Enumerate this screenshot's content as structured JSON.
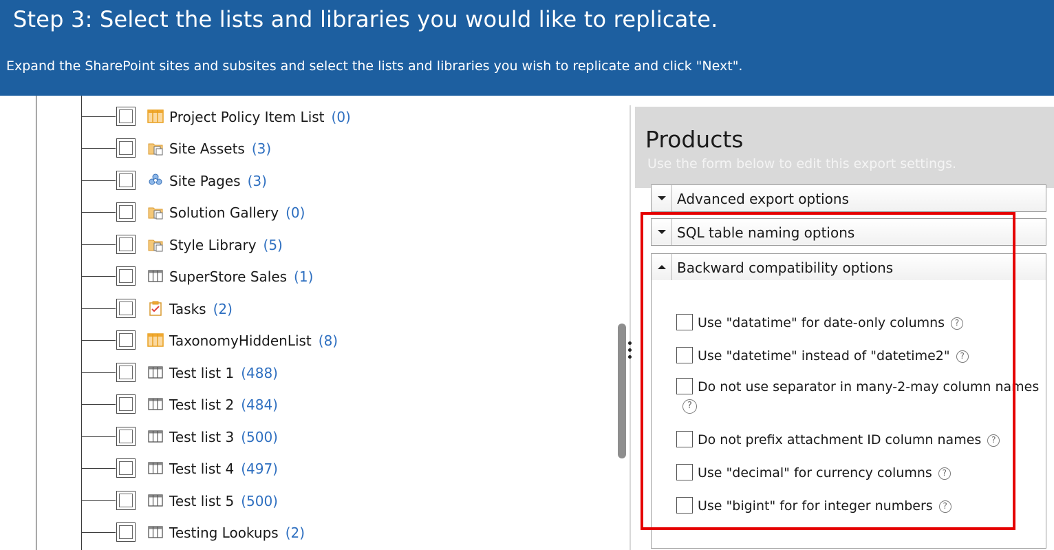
{
  "header": {
    "title": "Step 3: Select the lists and libraries you would like to replicate.",
    "subtitle": "Expand the SharePoint sites and subsites and select the lists and libraries you wish to replicate and click \"Next\"."
  },
  "tree": {
    "items": [
      {
        "label": "Project Policy Item List",
        "count": "(0)",
        "icon": "table-orange-icon"
      },
      {
        "label": "Site Assets",
        "count": "(3)",
        "icon": "library-icon"
      },
      {
        "label": "Site Pages",
        "count": "(3)",
        "icon": "site-pages-icon"
      },
      {
        "label": "Solution Gallery",
        "count": "(0)",
        "icon": "library-icon"
      },
      {
        "label": "Style Library",
        "count": "(5)",
        "icon": "library-icon"
      },
      {
        "label": "SuperStore Sales",
        "count": "(1)",
        "icon": "list-icon"
      },
      {
        "label": "Tasks",
        "count": "(2)",
        "icon": "tasks-icon"
      },
      {
        "label": "TaxonomyHiddenList",
        "count": "(8)",
        "icon": "table-orange-icon"
      },
      {
        "label": "Test list 1",
        "count": "(488)",
        "icon": "list-icon"
      },
      {
        "label": "Test list 2",
        "count": "(484)",
        "icon": "list-icon"
      },
      {
        "label": "Test list 3",
        "count": "(500)",
        "icon": "list-icon"
      },
      {
        "label": "Test list 4",
        "count": "(497)",
        "icon": "list-icon"
      },
      {
        "label": "Test list 5",
        "count": "(500)",
        "icon": "list-icon"
      },
      {
        "label": "Testing Lookups",
        "count": "(2)",
        "icon": "list-icon"
      }
    ]
  },
  "panel": {
    "title": "Products",
    "subtitle": "Use the form below to edit this export settings.",
    "sections": [
      {
        "label": "Advanced export options",
        "expanded": false
      },
      {
        "label": "SQL table naming options",
        "expanded": false
      },
      {
        "label": "Backward compatibility options",
        "expanded": true
      }
    ],
    "options": [
      {
        "label": "Use \"datatime\" for date-only columns"
      },
      {
        "label": "Use \"datetime\" instead of \"datetime2\""
      },
      {
        "label": "Do not use separator in many-2-may column names"
      },
      {
        "label": "Do not prefix attachment ID column names"
      },
      {
        "label": "Use \"decimal\" for currency columns"
      },
      {
        "label": "Use \"bigint\" for for integer numbers"
      }
    ],
    "help_glyph": "?"
  },
  "colors": {
    "header_bg": "#1d5fa0",
    "count_text": "#2e6fc0",
    "highlight": "#e50000"
  }
}
